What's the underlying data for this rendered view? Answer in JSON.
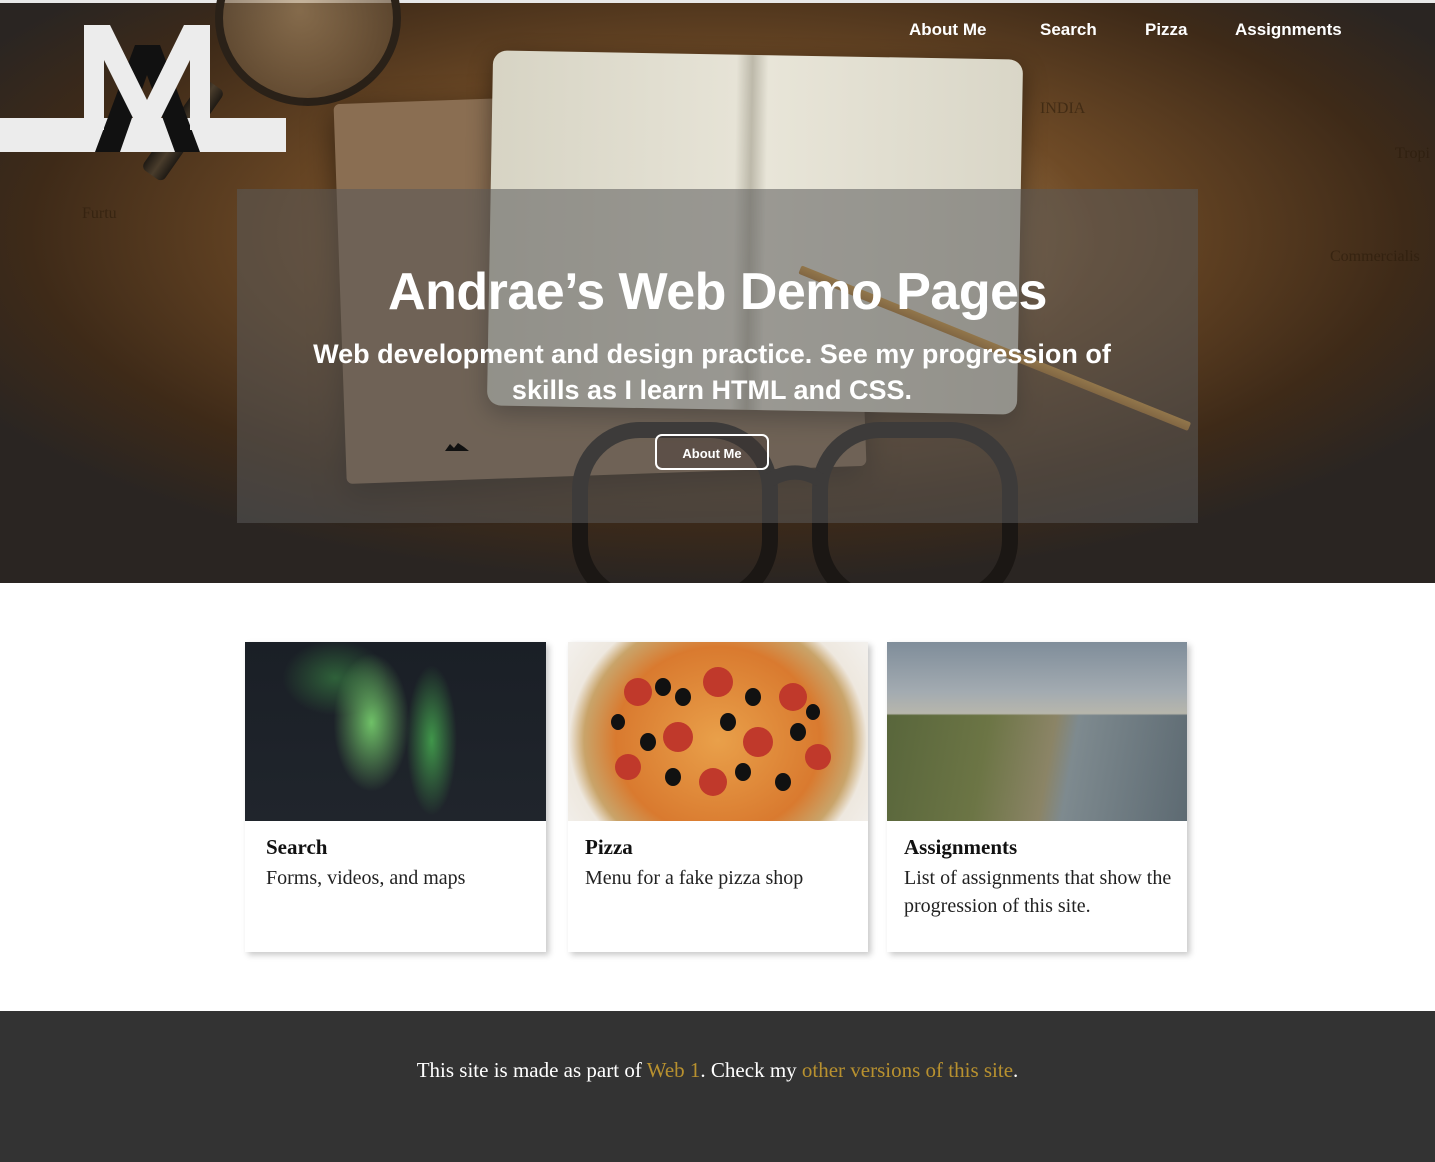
{
  "nav": {
    "about": "About Me",
    "search": "Search",
    "pizza": "Pizza",
    "assignments": "Assignments"
  },
  "hero": {
    "title": "Andrae’s Web Demo Pages",
    "subtitle": "Web development and design practice. See my progression of skills as I learn HTML and CSS.",
    "button": "About Me",
    "map_words": [
      "INDIA",
      "Tropi",
      "Commercialis",
      "Furtu"
    ]
  },
  "cards": [
    {
      "title": "Search",
      "desc": "Forms, videos, and maps",
      "image": "aurora-image"
    },
    {
      "title": "Pizza",
      "desc": "Menu for a fake pizza shop",
      "image": "pizza-image"
    },
    {
      "title": "Assignments",
      "desc": "List of assignments that show the progression of this site.",
      "image": "coast-image"
    }
  ],
  "footer": {
    "prefix": "This site is made as part of ",
    "link1": "Web 1",
    "middle": ". Check my ",
    "link2": "other versions of this site",
    "suffix": "."
  },
  "colors": {
    "accent": "#b8912f",
    "footer_bg": "#333333",
    "overlay": "rgba(90,90,90,0.55)"
  }
}
